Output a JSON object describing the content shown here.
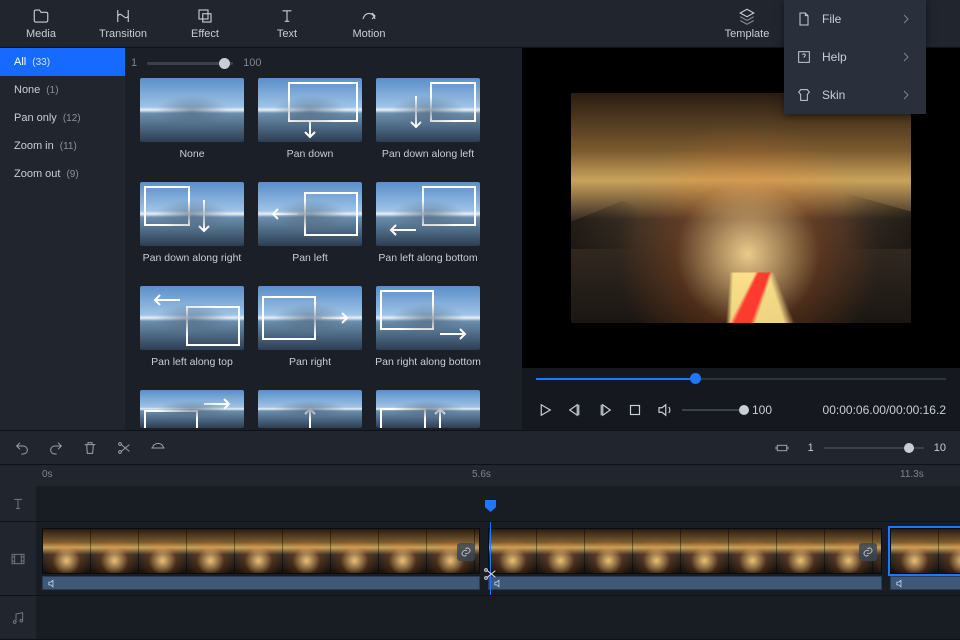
{
  "toolbar": {
    "media": "Media",
    "transition": "Transition",
    "effect": "Effect",
    "text": "Text",
    "motion": "Motion",
    "template": "Template"
  },
  "menu": {
    "file": "File",
    "help": "Help",
    "skin": "Skin"
  },
  "cats": {
    "all": {
      "label": "All",
      "count": "(33)"
    },
    "none": {
      "label": "None",
      "count": "(1)"
    },
    "pan": {
      "label": "Pan only",
      "count": "(12)"
    },
    "zin": {
      "label": "Zoom in",
      "count": "(11)"
    },
    "zout": {
      "label": "Zoom out",
      "count": "(9)"
    }
  },
  "gridZoom": {
    "min": "1",
    "max": "100"
  },
  "tiles": [
    "None",
    "Pan down",
    "Pan down along left",
    "Pan down along right",
    "Pan left",
    "Pan left along bottom",
    "Pan left along top",
    "Pan right",
    "Pan right along bottom"
  ],
  "volume": "100",
  "timecode": "00:00:06.00/00:00:16.2",
  "tlZoom": {
    "min": "1",
    "max": "10"
  },
  "ruler": {
    "t0": "0s",
    "t1": "5.6s",
    "t2": "11.3s"
  }
}
